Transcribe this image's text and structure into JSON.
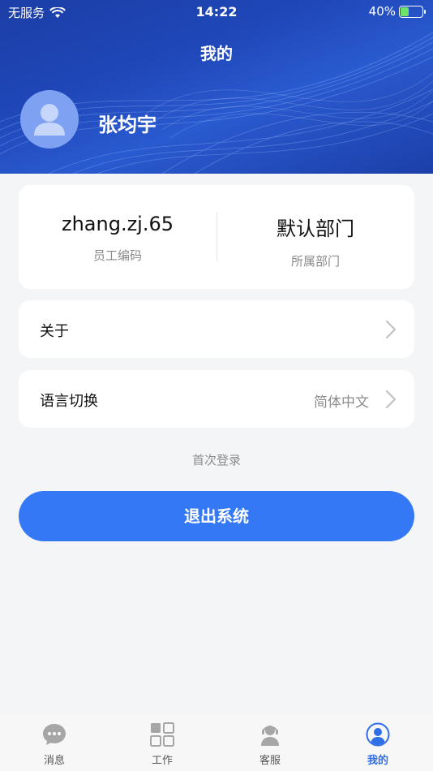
{
  "status_bar": {
    "carrier": "无服务",
    "time": "14:22",
    "battery_percent": "40%",
    "battery_level": 0.4
  },
  "header": {
    "title": "我的",
    "user_name": "张均宇",
    "avatar_icon": "user-avatar-icon"
  },
  "profile": {
    "employee_code_value": "zhang.zj.65",
    "employee_code_label": "员工编码",
    "department_value": "默认部门",
    "department_label": "所属部门"
  },
  "settings": {
    "about_label": "关于",
    "language_label": "语言切换",
    "language_value": "简体中文"
  },
  "login_note": "首次登录",
  "logout_label": "退出系统",
  "tabs": [
    {
      "label": "消息",
      "icon": "chat-bubble-icon",
      "active": false
    },
    {
      "label": "工作",
      "icon": "grid-icon",
      "active": false
    },
    {
      "label": "客服",
      "icon": "headset-agent-icon",
      "active": false
    },
    {
      "label": "我的",
      "icon": "user-circle-icon",
      "active": true
    }
  ],
  "colors": {
    "header_bg": "#1f47b8",
    "primary": "#3478f6",
    "active_tab": "#2f6ee6",
    "battery_fill": "#6ee36a"
  }
}
